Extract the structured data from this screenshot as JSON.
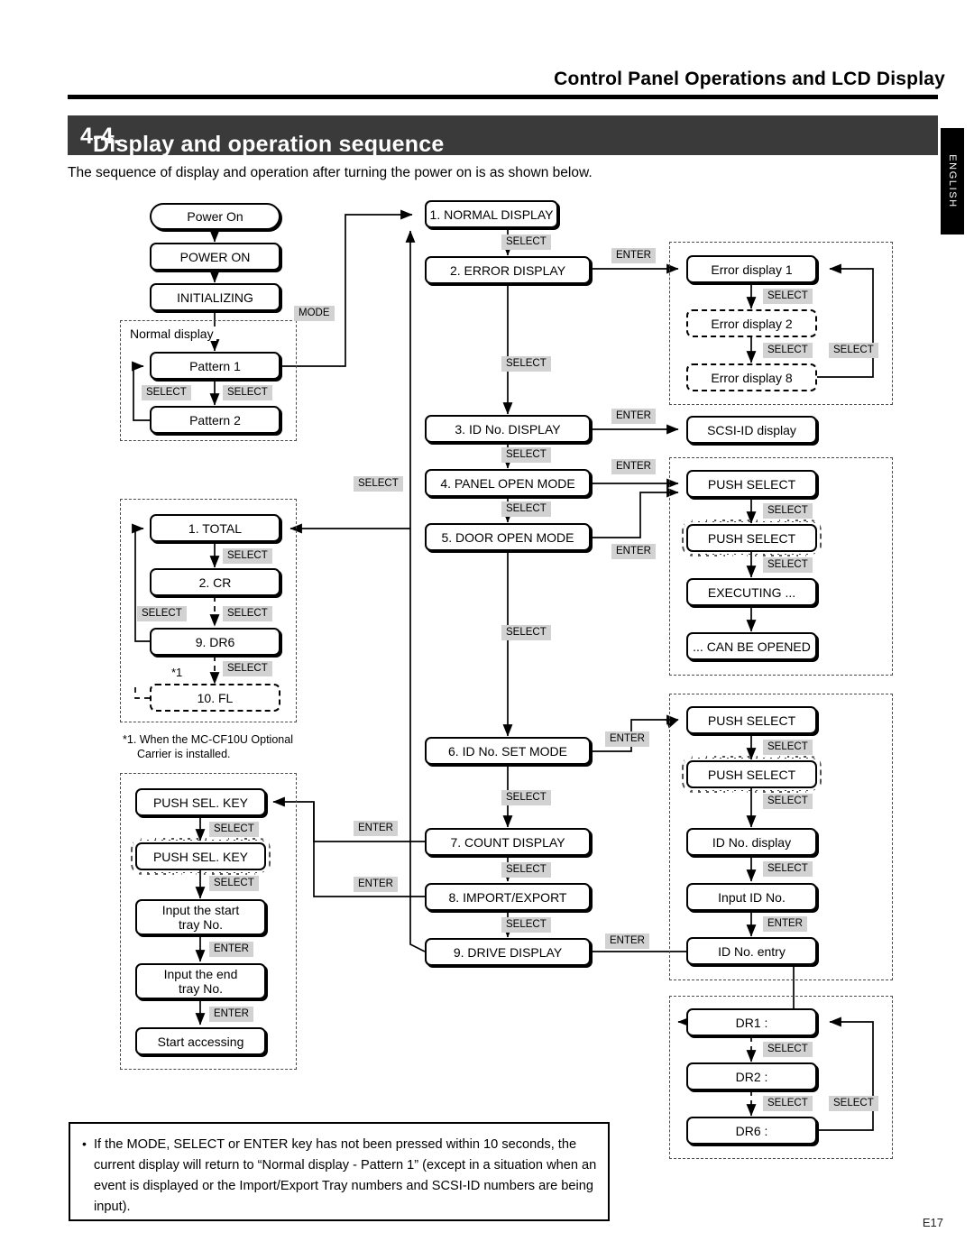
{
  "header": {
    "running_title": "Control Panel Operations and LCD Display",
    "section_number": "4-4.",
    "section_title": "Display and operation sequence",
    "intro": "The sequence of display and operation after turning the power on is as shown below.",
    "language_tab": "ENGLISH"
  },
  "footer": {
    "page_number": "E17"
  },
  "keys": {
    "mode": "MODE",
    "select": "SELECT",
    "enter": "ENTER"
  },
  "startup": {
    "power_on": "Power On",
    "power_on_display": "POWER ON",
    "initializing": "INITIALIZING",
    "normal_display_label": "Normal display",
    "pattern1": "Pattern 1",
    "pattern2": "Pattern 2"
  },
  "count_group": {
    "total": "1. TOTAL",
    "cr": "2. CR",
    "dr6": "9. DR6",
    "fl": "10. FL",
    "ref_mark": "*1",
    "footnote_line1": "*1. When the MC-CF10U Optional",
    "footnote_line2": "Carrier is installed."
  },
  "tray_group": {
    "push_sel_key_1": "PUSH SEL. KEY",
    "push_sel_key_2": "PUSH SEL. KEY",
    "input_start_tray": "Input the start\ntray No.",
    "input_start_tray_l1": "Input the start",
    "input_start_tray_l2": "tray No.",
    "input_end_tray_l1": "Input the end",
    "input_end_tray_l2": "tray No.",
    "start_accessing": "Start accessing"
  },
  "main_menu": [
    {
      "label": "1. NORMAL DISPLAY"
    },
    {
      "label": "2. ERROR DISPLAY"
    },
    {
      "label": "3. ID No. DISPLAY"
    },
    {
      "label": "4. PANEL OPEN MODE"
    },
    {
      "label": "5. DOOR OPEN MODE"
    },
    {
      "label": "6. ID No. SET MODE"
    },
    {
      "label": "7. COUNT DISPLAY"
    },
    {
      "label": "8. IMPORT/EXPORT"
    },
    {
      "label": "9. DRIVE DISPLAY"
    }
  ],
  "error_group": {
    "error1": "Error display 1",
    "error2": "Error display 2",
    "error8": "Error display 8"
  },
  "scsi_id_display": "SCSI-ID display",
  "open_group": {
    "push_select_1": "PUSH SELECT",
    "push_select_2": "PUSH SELECT",
    "executing": "EXECUTING ...",
    "can_be_opened": "... CAN BE OPENED"
  },
  "id_group": {
    "push_select_1": "PUSH SELECT",
    "push_select_2": "PUSH SELECT",
    "id_no_display": "ID No. display",
    "input_id_no": "Input ID No.",
    "id_no_entry": "ID No. entry"
  },
  "drive_group": {
    "dr1": "DR1 :",
    "dr2": "DR2 :",
    "dr6": "DR6 :"
  },
  "note": {
    "bullet": "•",
    "text": "If the MODE, SELECT or ENTER key has not been pressed within 10 seconds, the current display will return to “Normal display - Pattern 1” (except in a situation when an event is displayed or the Import/Export Tray numbers and SCSI-ID numbers are being input)."
  },
  "colors": {
    "key_badge_bg": "#d2d2d2",
    "section_bar_bg": "#3a3a3a",
    "ink": "#000000"
  }
}
